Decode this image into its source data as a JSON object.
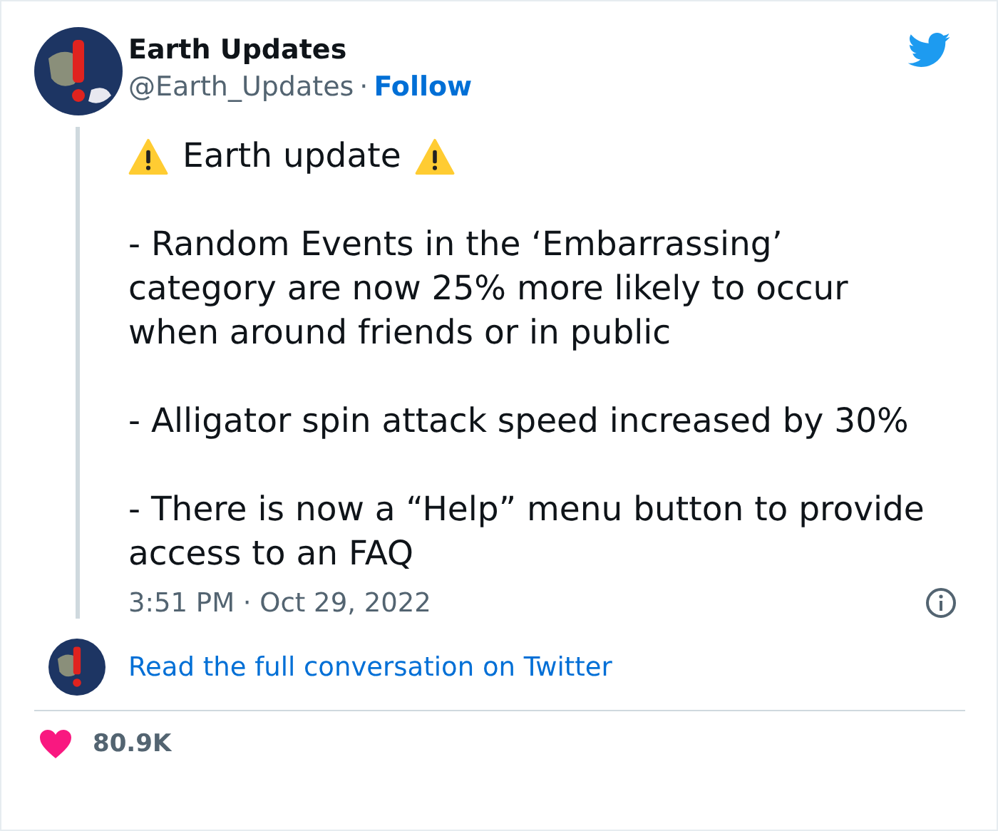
{
  "author": {
    "name": "Earth Updates",
    "handle": "@Earth_Updates",
    "separator": "·",
    "follow": "Follow"
  },
  "tweet": {
    "headline": "Earth update",
    "paragraphs": [
      "- Random Events in the ‘Embarrassing’ category are now 25% more likely to occur when around friends or in public",
      "- Alligator spin attack speed increased by 30%",
      "- There is now a “Help” menu button to provide access to an FAQ"
    ],
    "timestamp": "3:51 PM · Oct 29, 2022"
  },
  "conversation_link": "Read the full conversation on Twitter",
  "likes": "80.9K"
}
